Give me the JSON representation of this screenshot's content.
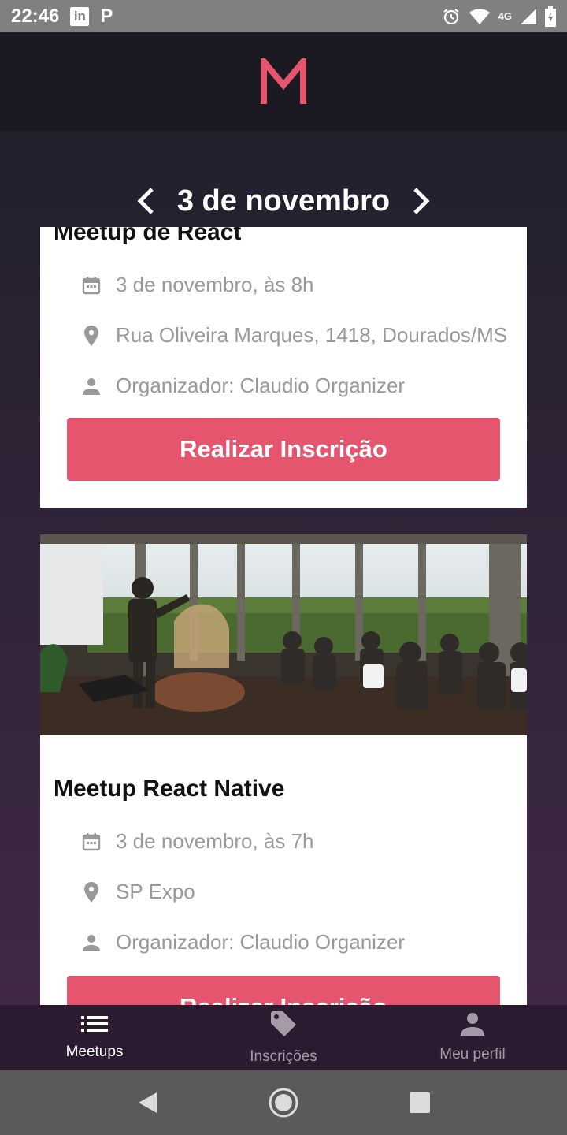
{
  "status_bar": {
    "time": "22:46",
    "left_icons": [
      "linkedin-icon",
      "p-icon"
    ],
    "network_label": "4G",
    "right_icons": [
      "alarm-icon",
      "wifi-icon",
      "signal-icon",
      "battery-icon"
    ]
  },
  "header": {
    "logo_letter": "M",
    "logo_color": "#e5556e"
  },
  "date_nav": {
    "title": "3 de novembro"
  },
  "meetups": [
    {
      "title": "Meetup de React",
      "date": "3 de novembro, às  8h",
      "location": "Rua Oliveira Marques, 1418, Dourados/MS",
      "organizer": "Organizador: Claudio Organizer",
      "button_label": "Realizar Inscrição",
      "has_image": false
    },
    {
      "title": "Meetup React Native",
      "date": "3 de novembro, às  7h",
      "location": "SP Expo",
      "organizer": "Organizador: Claudio Organizer",
      "button_label": "Realizar Inscrição",
      "has_image": true,
      "image_alt": "meetup-audience-photo"
    }
  ],
  "tabs": [
    {
      "label": "Meetups",
      "icon": "list-icon",
      "active": true
    },
    {
      "label": "Inscrições",
      "icon": "tag-icon",
      "active": false
    },
    {
      "label": "Meu perfil",
      "icon": "person-icon",
      "active": false
    }
  ],
  "colors": {
    "accent": "#e5556e",
    "header_bg": "#1b1921",
    "gradient_top": "#22202c",
    "gradient_bottom": "#402845"
  }
}
